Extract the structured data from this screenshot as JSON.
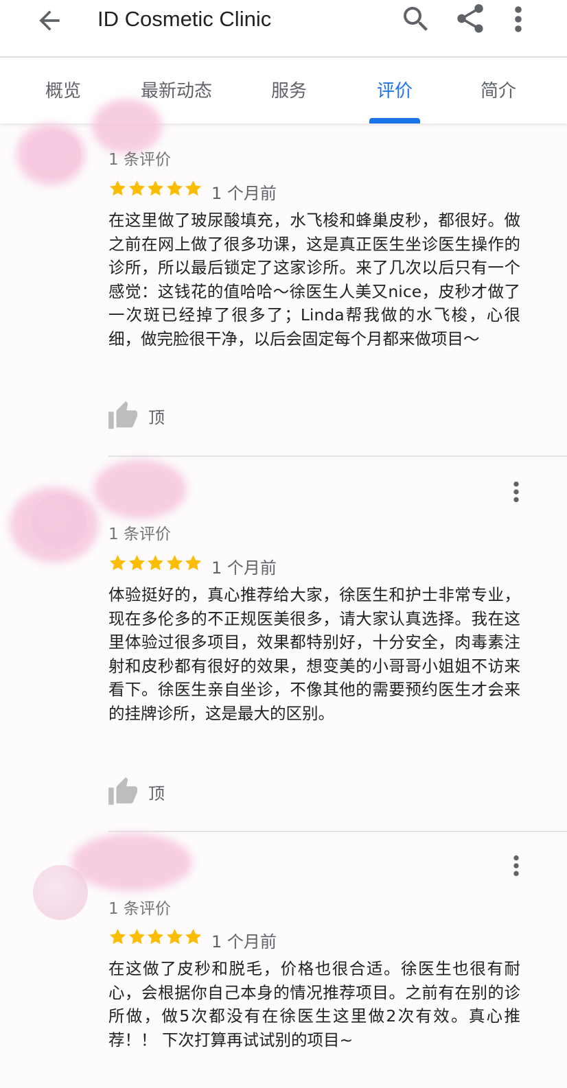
{
  "app_bar": {
    "title": "ID Cosmetic Clinic",
    "icons": [
      "back-arrow-icon",
      "search-icon",
      "share-icon",
      "more-vert-icon"
    ]
  },
  "tabs": [
    {
      "label": "概览",
      "active": false
    },
    {
      "label": "最新动态",
      "active": false
    },
    {
      "label": "服务",
      "active": false
    },
    {
      "label": "评价",
      "active": true
    },
    {
      "label": "简介",
      "active": false
    }
  ],
  "colors": {
    "accent": "#1a73e8",
    "star": "#fbbc04",
    "text_secondary": "#757575",
    "redaction": "#f6c4dd"
  },
  "reviews": [
    {
      "review_count": "1 条评价",
      "rating": 5,
      "date": "1 个月前",
      "text": "在这里做了玻尿酸填充，水飞梭和蜂巢皮秒，都很好。做之前在网上做了很多功课，这是真正医生坐诊医生操作的诊所，所以最后锁定了这家诊所。来了几次以后只有一个感觉：这钱花的值哈哈～徐医生人美又nice，皮秒才做了一次斑已经掉了很多了；Linda帮我做的水飞梭，心很细，做完脸很干净，以后会固定每个月都来做项目～",
      "like_label": "顶"
    },
    {
      "review_count": "1 条评价",
      "rating": 5,
      "date": "1 个月前",
      "text": "体验挺好的，真心推荐给大家，徐医生和护士非常专业，现在多伦多的不正规医美很多，请大家认真选择。我在这里体验过很多项目，效果都特别好，十分安全，肉毒素注射和皮秒都有很好的效果，想变美的小哥哥小姐姐不访来看下。徐医生亲自坐诊，不像其他的需要预约医生才会来的挂牌诊所，这是最大的区别。",
      "like_label": "顶"
    },
    {
      "review_count": "1 条评价",
      "rating": 5,
      "date": "1 个月前",
      "text": "在这做了皮秒和脱毛，价格也很合适。徐医生也很有耐心，会根据你自己本身的情况推荐项目。之前有在别的诊所做，做5次都没有在徐医生这里做2次有效。真心推荐！！ 下次打算再试试别的项目~",
      "like_label": "顶"
    }
  ]
}
